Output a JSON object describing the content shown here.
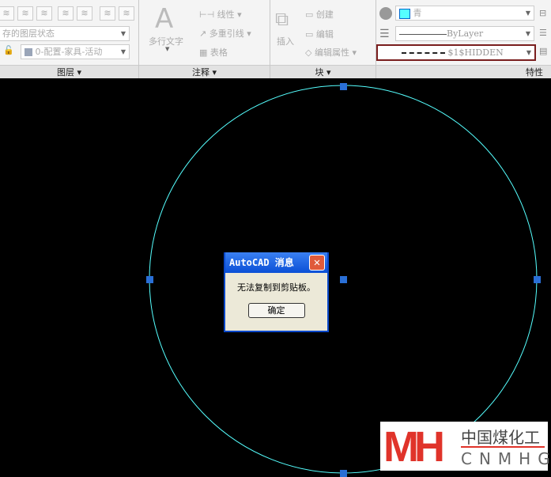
{
  "layers": {
    "title": "图层",
    "state_combo": "存的图层状态",
    "layer_combo": "0-配置-家具-活动"
  },
  "annotation": {
    "title": "注释",
    "mtext": "多行文字",
    "linear": "线性",
    "mleader": "多重引线",
    "table": "表格"
  },
  "block": {
    "title": "块",
    "insert": "插入",
    "create": "创建",
    "edit": "编辑",
    "edit_attr": "编辑属性"
  },
  "properties": {
    "title": "特性",
    "color": "青",
    "color_hex": "#55ffff",
    "lineweight": "ByLayer",
    "linetype": "$1$HIDDEN"
  },
  "dialog": {
    "title": "AutoCAD 消息",
    "message": "无法复制到剪贴板。",
    "ok": "确定",
    "close": "✕"
  },
  "watermark": {
    "cn": "中国煤化工",
    "en": "CNMHG",
    "mark": "MH"
  }
}
